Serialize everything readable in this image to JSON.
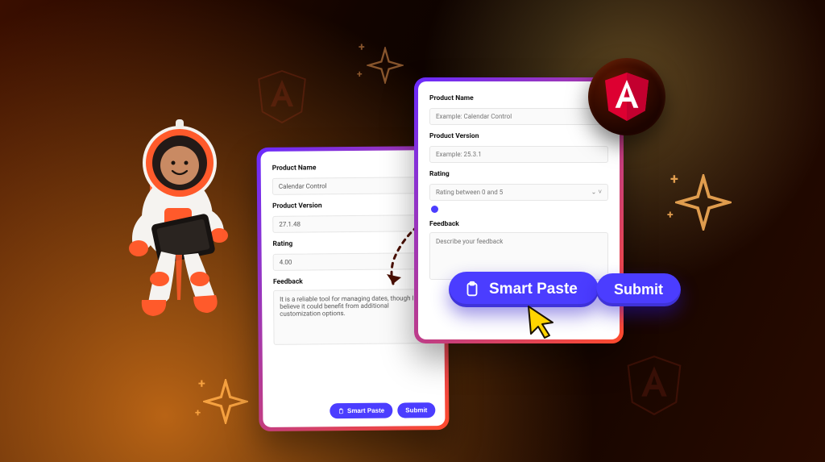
{
  "colors": {
    "accent": "#4b3dff",
    "brand_red": "#dd0031"
  },
  "form_back": {
    "product_name": {
      "label": "Product Name",
      "value": "Calendar Control"
    },
    "product_version": {
      "label": "Product Version",
      "value": "27.1.48"
    },
    "rating": {
      "label": "Rating",
      "value": "4.00"
    },
    "feedback": {
      "label": "Feedback",
      "value": "It is a reliable tool for managing dates, though I believe it could benefit from additional customization options."
    },
    "smart_paste_label": "Smart Paste",
    "submit_label": "Submit"
  },
  "form_front": {
    "product_name": {
      "label": "Product Name",
      "placeholder": "Example: Calendar Control"
    },
    "product_version": {
      "label": "Product Version",
      "placeholder": "Example: 25.3.1"
    },
    "rating": {
      "label": "Rating",
      "placeholder": "Rating between 0 and 5"
    },
    "feedback": {
      "label": "Feedback",
      "placeholder": "Describe your feedback"
    }
  },
  "callout": {
    "smart_paste_label": "Smart Paste",
    "submit_label": "Submit"
  }
}
